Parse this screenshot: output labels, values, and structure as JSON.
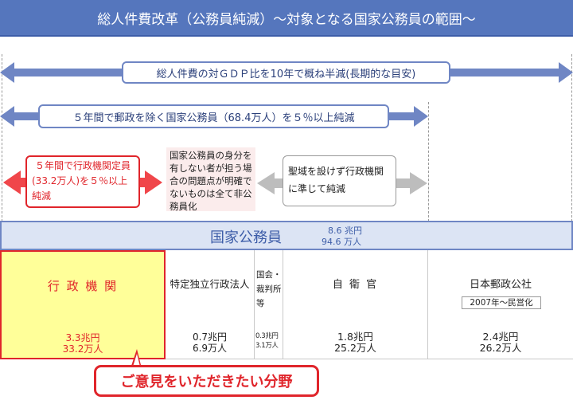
{
  "title": "総人件費改革（公務員純減）〜対象となる国家公務員の範囲〜",
  "arrows": {
    "gdp": "総人件費の対ＧＤＰ比を10年で概ね半減(長期的な目安)",
    "five_year": "５年間で郵政を除く国家公務員（68.4万人）を５％以上純減",
    "gyosei_line1": "５年間で行政機関定員",
    "gyosei_line2": "(33.2万人)を５％以上",
    "gyosei_line3": "純減",
    "middle_note": "国家公務員の身分を有しない者が担う場合の問題点が明確でないものは全て非公務員化",
    "seiiki_line1": "聖域を設けず行政機関",
    "seiiki_line2": "に準じて純減"
  },
  "kokka": {
    "label": "国家公務員",
    "amount": "8.6 兆円",
    "people": "94.6 万人"
  },
  "categories": [
    {
      "name": "行 政 機 関",
      "amount": "3.3兆円",
      "people": "33.2万人"
    },
    {
      "name": "特定独立行政法人",
      "amount": "0.7兆円",
      "people": "6.9万人"
    },
    {
      "name": "国会・裁判所等",
      "amount": "0.3兆円",
      "people": "3.1万人"
    },
    {
      "name": "自 衛 官",
      "amount": "1.8兆円",
      "people": "25.2万人"
    },
    {
      "name": "日本郵政公社",
      "note": "2007年〜民営化",
      "amount": "2.4兆円",
      "people": "26.2万人"
    }
  ],
  "callout": "ご意見をいただきたい分野",
  "colors": {
    "accent_blue": "#5576bd",
    "highlight": "#ffff99",
    "red": "#e0252b",
    "gray_arrow": "#bdbdbd"
  }
}
